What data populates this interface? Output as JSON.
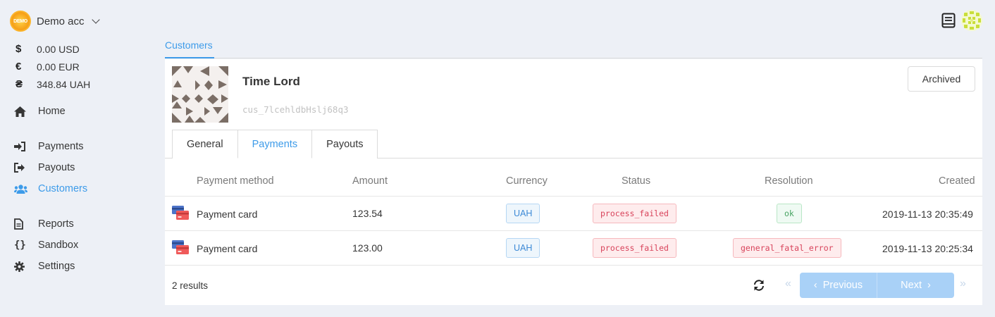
{
  "account": {
    "logo_text": "DEMO",
    "name": "Demo acc"
  },
  "balances": [
    {
      "symbol": "$",
      "amount": "0.00 USD"
    },
    {
      "symbol": "€",
      "amount": "0.00 EUR"
    },
    {
      "symbol": "₴",
      "amount": "348.84 UAH"
    }
  ],
  "nav": {
    "home": "Home",
    "payments": "Payments",
    "payouts": "Payouts",
    "customers": "Customers",
    "reports": "Reports",
    "sandbox": "Sandbox",
    "settings": "Settings"
  },
  "breadcrumb": "Customers",
  "customer": {
    "name": "Time Lord",
    "id": "cus_7lcehldbHslj68q3",
    "archived_label": "Archived"
  },
  "tabs": [
    "General",
    "Payments",
    "Payouts"
  ],
  "table": {
    "headers": {
      "method": "Payment method",
      "amount": "Amount",
      "currency": "Currency",
      "status": "Status",
      "resolution": "Resolution",
      "created": "Created"
    },
    "rows": [
      {
        "method": "Payment card",
        "amount": "123.54",
        "currency": "UAH",
        "status": "process_failed",
        "resolution": "ok",
        "created": "2019-11-13 20:35:49"
      },
      {
        "method": "Payment card",
        "amount": "123.00",
        "currency": "UAH",
        "status": "process_failed",
        "resolution": "general_fatal_error",
        "created": "2019-11-13 20:25:34"
      }
    ]
  },
  "footer": {
    "results": "2 results",
    "previous": "Previous",
    "next": "Next"
  },
  "colors": {
    "accent": "#3d9be9",
    "pager": "#a9d1f7"
  }
}
